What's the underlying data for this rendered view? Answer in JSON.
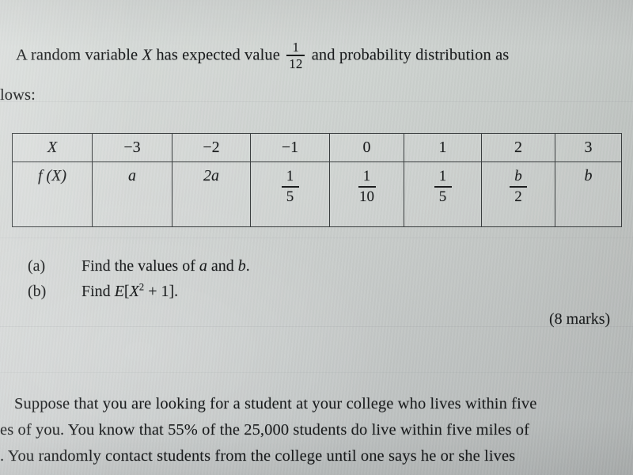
{
  "document": {
    "type": "exam-question-photo",
    "paper_color": "#cbcfcd",
    "ink_color": "#1a1c1d"
  },
  "question1": {
    "stem_line1_part1": "A  random  variable ",
    "stem_var": "X",
    "stem_line1_part2": " has  expected  value",
    "expected_value_fraction": {
      "numerator": "1",
      "denominator": "12"
    },
    "stem_line1_part3": "and  probability  distribution  as",
    "stem_line2": "lows:",
    "table": {
      "row_headers": [
        "X",
        "f (X)"
      ],
      "x_values": [
        "−3",
        "−2",
        "−1",
        "0",
        "1",
        "2",
        "3"
      ],
      "f_values": [
        {
          "kind": "plain",
          "text": "a"
        },
        {
          "kind": "plain",
          "text": "2a"
        },
        {
          "kind": "fraction",
          "numerator": "1",
          "denominator": "5"
        },
        {
          "kind": "fraction",
          "numerator": "1",
          "denominator": "10"
        },
        {
          "kind": "fraction",
          "numerator": "1",
          "denominator": "5"
        },
        {
          "kind": "fraction",
          "numerator": "b",
          "denominator": "2"
        },
        {
          "kind": "plain",
          "text": "b"
        }
      ]
    },
    "parts": [
      {
        "label": "(a)",
        "text_before": "Find the values of ",
        "var1": "a",
        "conjunction": " and ",
        "var2": "b",
        "text_after": "."
      },
      {
        "label": "(b)",
        "text_before": "Find ",
        "expr_fn": "E",
        "expr_open": "[",
        "expr_var": "X",
        "expr_exponent": "2",
        "expr_tail": " + 1",
        "expr_close": "]",
        "text_after": "."
      }
    ],
    "marks": "(8 marks)"
  },
  "question2": {
    "line1": "Suppose  that  you  are  looking  for  a  student  at  your  college  who  lives  within  five",
    "line2": "es of you. You know that 55% of the 25,000 students do live within five miles of",
    "line3": ". You  randomly  contact  students  from  the  college  until  one  says  he  or  she  lives"
  }
}
